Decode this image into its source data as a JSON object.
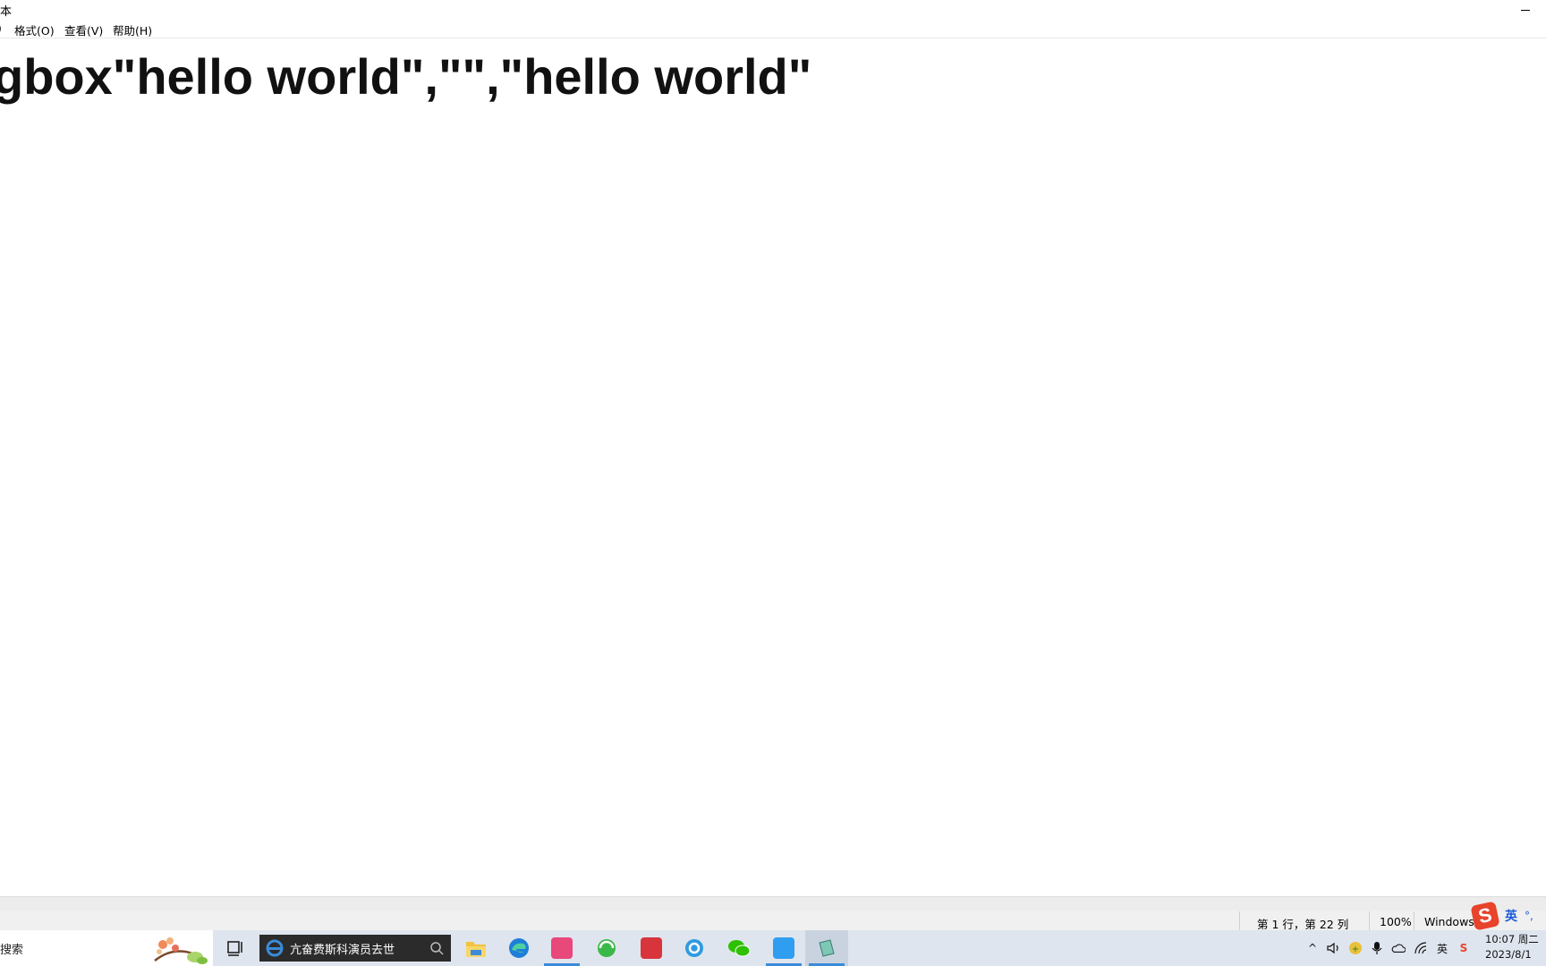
{
  "window": {
    "title": "本",
    "minimize_glyph": "—"
  },
  "menu": [
    {
      "label": ")"
    },
    {
      "label": "格式(O)"
    },
    {
      "label": "查看(V)"
    },
    {
      "label": "帮助(H)"
    }
  ],
  "editor": {
    "content": "gbox\"hello world\",\"\",\"hello world\""
  },
  "status": {
    "position": "第 1 行，第 22 列",
    "zoom": "100%",
    "line_ending": "Windows"
  },
  "ime": {
    "logo": "S",
    "mode": "英",
    "punct": "°,"
  },
  "taskbar": {
    "search_text": "搜索",
    "news_text": "亢奋费斯科演员去世",
    "icons": [
      "task-view-icon",
      "file-explorer-icon",
      "edge-icon",
      "photo-app-icon",
      "browser-360-icon",
      "wps-icon",
      "ie-icon",
      "wechat-icon",
      "notepad-blue-icon",
      "notepad-icon"
    ],
    "clock_time": "10:07 周二",
    "clock_date": "2023/8/1"
  },
  "tray": {
    "chevron": "^",
    "ime_lang": "英",
    "ime_s": "S"
  },
  "colors": {
    "taskbar_bg": "#dfe5ee",
    "accent_blue": "#3a8bd8",
    "sogou_red": "#e8432b"
  }
}
